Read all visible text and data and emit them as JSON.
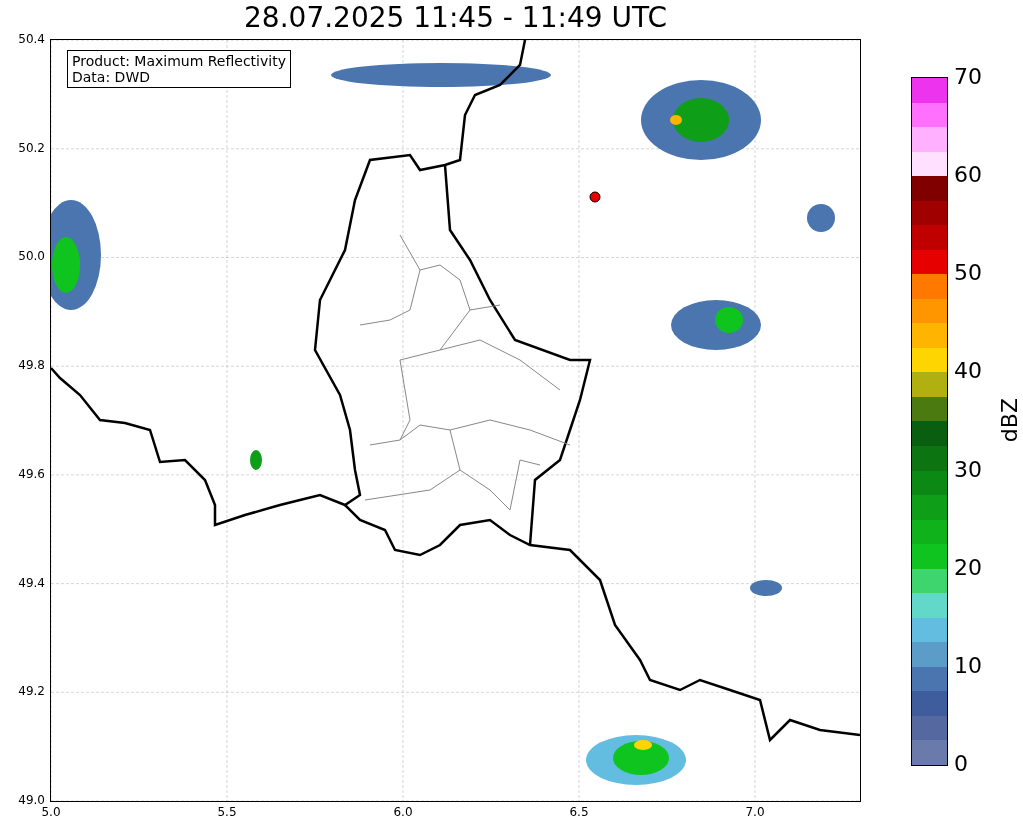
{
  "title": "28.07.2025 11:45 - 11:49 UTC",
  "info_box": {
    "lines": [
      "Product: Maximum Reflectivity",
      "Data: DWD"
    ]
  },
  "x_axis": {
    "ticks": [
      "5.0",
      "5.5",
      "6.0",
      "6.5",
      "7.0"
    ]
  },
  "y_axis": {
    "ticks": [
      "50.4",
      "50.2",
      "50.0",
      "49.8",
      "49.6",
      "49.4",
      "49.2",
      "49.0"
    ]
  },
  "colorbar": {
    "label": "dBZ",
    "ticks": [
      "70",
      "60",
      "50",
      "40",
      "30",
      "20",
      "10",
      "0"
    ],
    "segments": [
      {
        "color": "#6a7bab"
      },
      {
        "color": "#55689f"
      },
      {
        "color": "#3f5d9c"
      },
      {
        "color": "#4a75ae"
      },
      {
        "color": "#5b9dc8"
      },
      {
        "color": "#62bde0"
      },
      {
        "color": "#62d8c8"
      },
      {
        "color": "#3ed56e"
      },
      {
        "color": "#10c420"
      },
      {
        "color": "#0fb21a"
      },
      {
        "color": "#0e9e18"
      },
      {
        "color": "#0c8914"
      },
      {
        "color": "#0c7512"
      },
      {
        "color": "#0a5e10"
      },
      {
        "color": "#4a7a10"
      },
      {
        "color": "#b0b010"
      },
      {
        "color": "#ffd500"
      },
      {
        "color": "#ffb400"
      },
      {
        "color": "#ff9600"
      },
      {
        "color": "#ff7800"
      },
      {
        "color": "#e60000"
      },
      {
        "color": "#c00000"
      },
      {
        "color": "#a00000"
      },
      {
        "color": "#800000"
      },
      {
        "color": "#ffe0ff"
      },
      {
        "color": "#ffb0ff"
      },
      {
        "color": "#ff70ff"
      },
      {
        "color": "#ee33ee"
      }
    ]
  }
}
